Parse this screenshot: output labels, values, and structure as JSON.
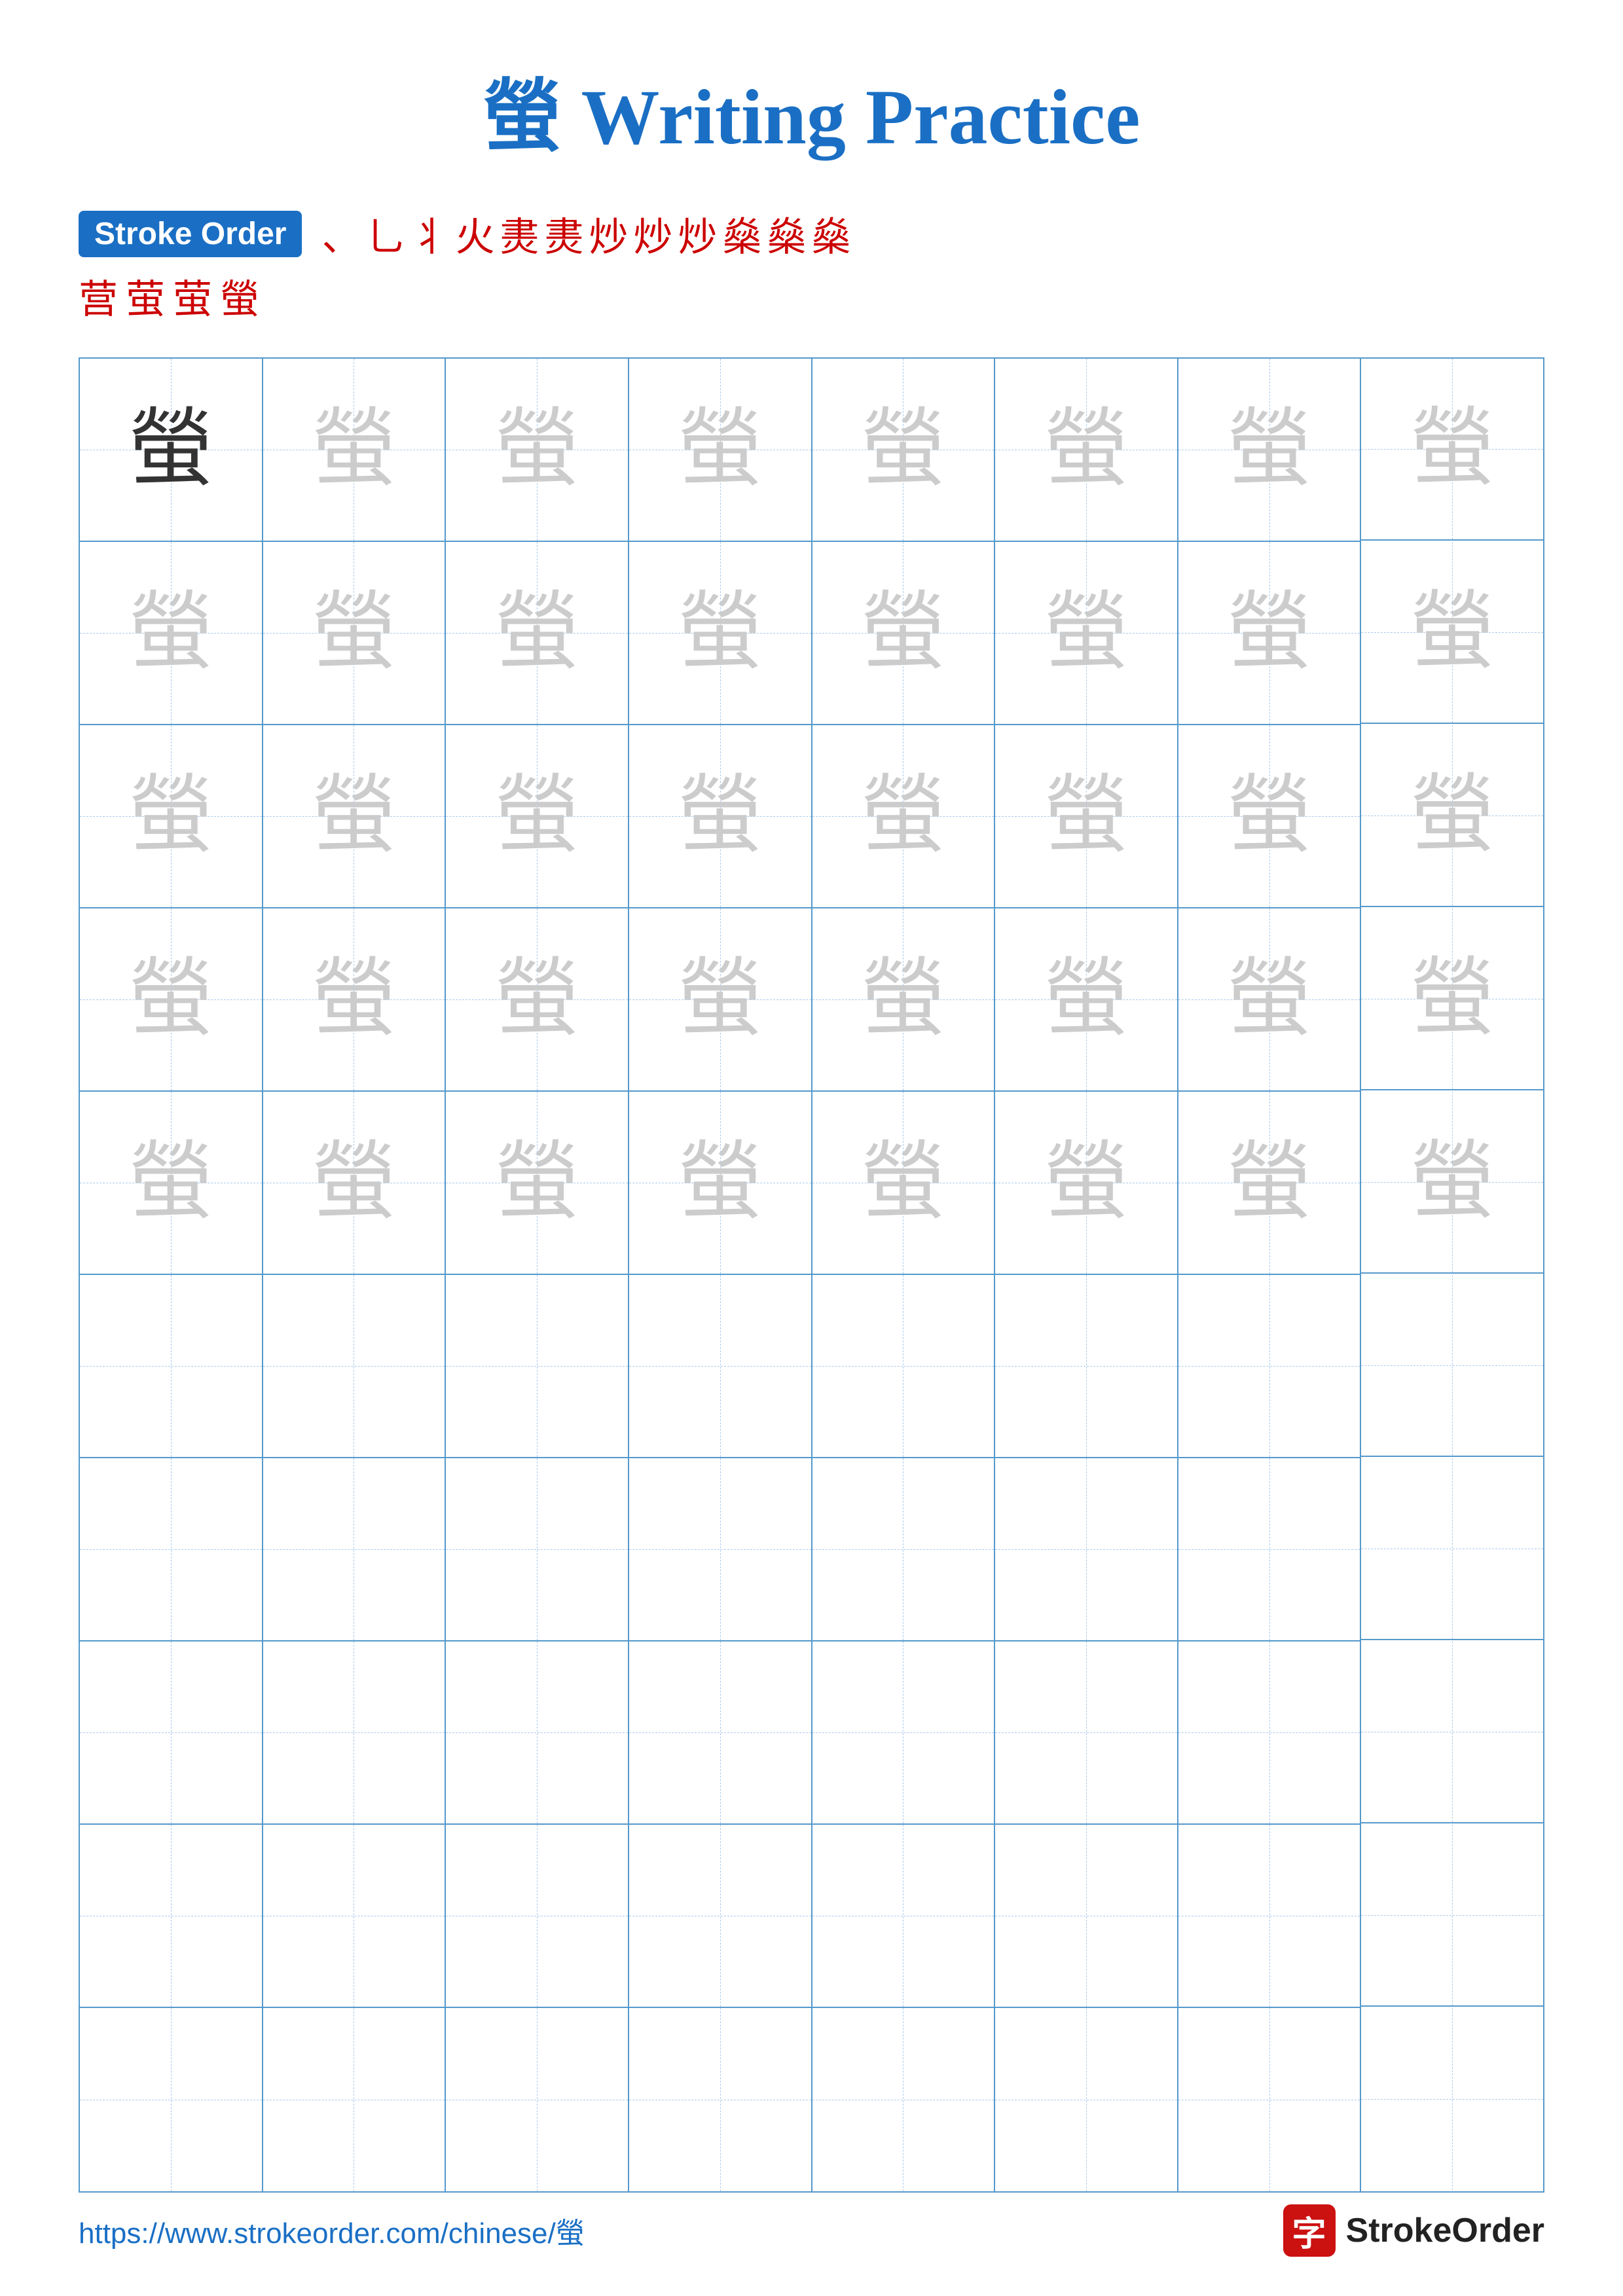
{
  "title": {
    "char": "螢",
    "text": " Writing Practice"
  },
  "strokeOrder": {
    "badge": "Stroke Order",
    "sequence_row1": [
      "、",
      "⺃",
      "丬",
      "火",
      "㶳",
      "㶳",
      "炒",
      "炒",
      "炒",
      "燊",
      "燊",
      "燊"
    ],
    "sequence_row2": [
      "营",
      "萤",
      "萤",
      "螢"
    ]
  },
  "grid": {
    "char": "螢",
    "rows": 10,
    "cols": 8,
    "guideRows": 5
  },
  "footer": {
    "url": "https://www.strokeorder.com/chinese/螢",
    "logoChar": "字",
    "logoText": "StrokeOrder"
  }
}
